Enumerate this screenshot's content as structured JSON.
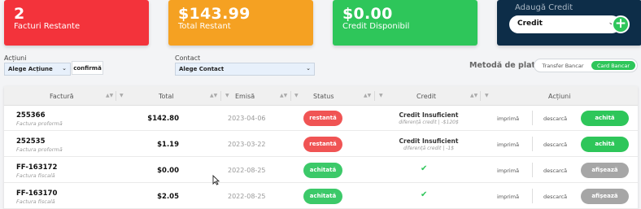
{
  "cards": {
    "unpaid": {
      "value": "2",
      "label": "Facturi Restante",
      "color": "#f3333b"
    },
    "total_due": {
      "value": "$143.99",
      "label": "Total Restant",
      "color": "#f5a122"
    },
    "credit": {
      "value": "$0.00",
      "label": "Credit Disponibil",
      "color": "#2ec65a"
    },
    "add_credit": {
      "title": "Adaugă Credit",
      "select_value": "Credit",
      "add_icon": "plus-icon"
    }
  },
  "actions": {
    "label": "Acțiuni",
    "select_value": "Alege Acțiune",
    "confirm_label": "confirmă"
  },
  "contact": {
    "label": "Contact",
    "select_value": "Alege Contact"
  },
  "payment": {
    "label": "Metodă de plată",
    "options": [
      "Transfer Bancar",
      "Card Bancar"
    ],
    "selected": "Card Bancar"
  },
  "table": {
    "headers": {
      "invoice": "Factură",
      "total": "Total",
      "issued": "Emisă",
      "status": "Status",
      "credit": "Credit",
      "actions": "Acțiuni"
    },
    "rows": [
      {
        "number": "255366",
        "type": "Factura proformă",
        "total": "$142.80",
        "date": "2023-04-06",
        "status": "restantă",
        "status_color": "#f05454",
        "credit_main": "Credit Insuficient",
        "credit_sub": "diferență credit | -$120$",
        "print": "imprimă",
        "download": "descarcă",
        "action": "achită",
        "action_color": "#2ec65a"
      },
      {
        "number": "252535",
        "type": "Factura proformă",
        "total": "$1.19",
        "date": "2023-03-22",
        "status": "restantă",
        "status_color": "#f05454",
        "credit_main": "Credit Insuficient",
        "credit_sub": "diferență credit | -1$",
        "print": "imprimă",
        "download": "descarcă",
        "action": "achită",
        "action_color": "#2ec65a"
      },
      {
        "number": "FF-163172",
        "type": "Factura fiscală",
        "total": "$0.00",
        "date": "2022-08-25",
        "status": "achitată",
        "status_color": "#3cc969",
        "credit_check": "✔",
        "print": "imprimă",
        "download": "descarcă",
        "action": "afișează",
        "action_color": "#a6a6a6"
      },
      {
        "number": "FF-163170",
        "type": "Factura fiscală",
        "total": "$2.05",
        "date": "2022-08-25",
        "status": "achitată",
        "status_color": "#3cc969",
        "credit_check": "✔",
        "print": "imprimă",
        "download": "descarcă",
        "action": "afișează",
        "action_color": "#a6a6a6"
      }
    ]
  }
}
